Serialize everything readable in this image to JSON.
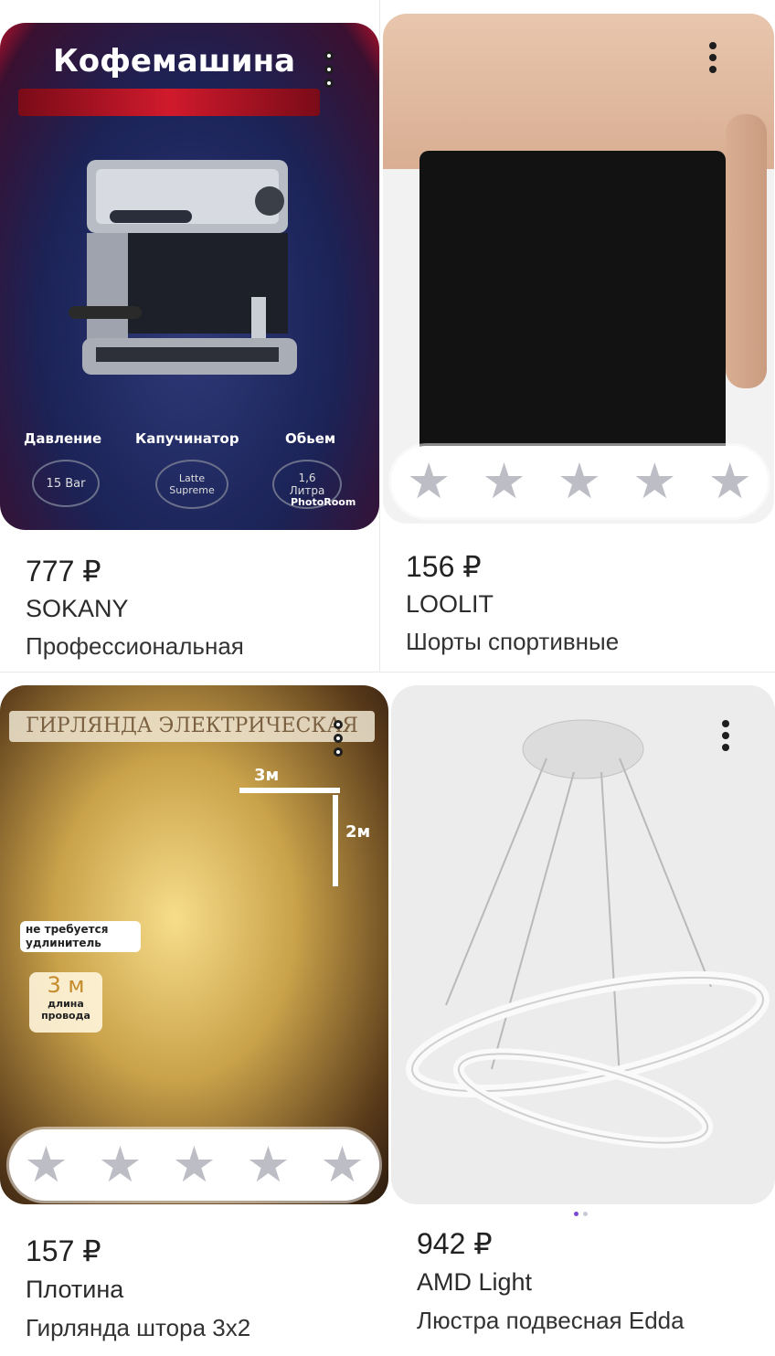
{
  "products": [
    {
      "price": "777 ₽",
      "brand": "SOKANY",
      "title": " Профессиональная",
      "image": {
        "headline": "Кофемашина",
        "features": [
          "Давление",
          "Капучинатор",
          "Обьем"
        ],
        "badges": [
          "15 Bar",
          "Latte Supreme",
          "1,6 Литра"
        ],
        "watermark": "PhotoRoom"
      }
    },
    {
      "price": "156 ₽",
      "brand": "LOOLIT",
      "title": "Шорты спортивные",
      "rating_stars": 5
    },
    {
      "price": "157 ₽",
      "brand": "Плотина",
      "title": "Гирлянда штора 3х2",
      "rating_stars": 5,
      "image": {
        "headline": "ГИРЛЯНДА ЭЛЕКТРИЧЕСКАЯ",
        "width_label": "3м",
        "height_label": "2м",
        "note": "не требуется удлинитель",
        "cable_length": "3 м",
        "cable_label": "длина провода"
      }
    },
    {
      "price": "942 ₽",
      "brand": "AMD Light",
      "title": "Люстра подвесная Edda"
    }
  ],
  "colors": {
    "accent": "#7b47d6",
    "star_inactive": "#bdbdc6"
  }
}
